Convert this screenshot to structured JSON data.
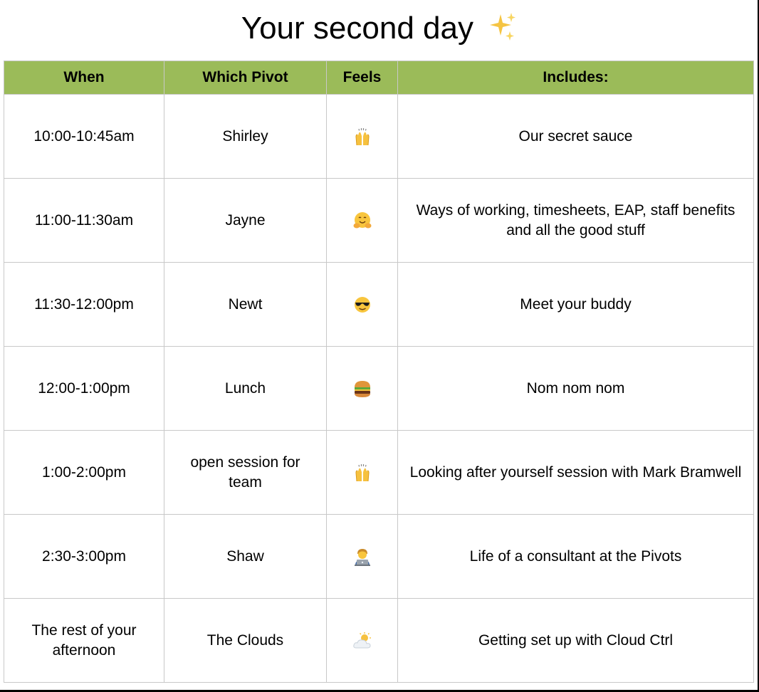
{
  "title": "Your second day",
  "title_icon": "sparkles-icon",
  "header": {
    "when": "When",
    "pivot": "Which Pivot",
    "feels": "Feels",
    "includes": "Includes:"
  },
  "rows": [
    {
      "when": "10:00-10:45am",
      "pivot": "Shirley",
      "feels": "raised-hands-icon",
      "includes": "Our secret sauce"
    },
    {
      "when": "11:00-11:30am",
      "pivot": "Jayne",
      "feels": "hugging-face-icon",
      "includes": "Ways of working, timesheets, EAP, staff benefits and all the good stuff"
    },
    {
      "when": "11:30-12:00pm",
      "pivot": "Newt",
      "feels": "sunglasses-face-icon",
      "includes": "Meet your buddy"
    },
    {
      "when": "12:00-1:00pm",
      "pivot": "Lunch",
      "feels": "hamburger-icon",
      "includes": "Nom nom nom"
    },
    {
      "when": "1:00-2:00pm",
      "pivot": "open session for team",
      "feels": "raised-hands-icon",
      "includes": "Looking after yourself session with Mark Bramwell"
    },
    {
      "when": "2:30-3:00pm",
      "pivot": "Shaw",
      "feels": "technologist-icon",
      "includes": "Life of a consultant at the Pivots"
    },
    {
      "when": "The rest of your afternoon",
      "pivot": "The Clouds",
      "feels": "sun-behind-cloud-icon",
      "includes": "Getting set up with Cloud Ctrl"
    }
  ],
  "colors": {
    "header_bg": "#9bbb59",
    "grid": "#c8c8c8"
  }
}
